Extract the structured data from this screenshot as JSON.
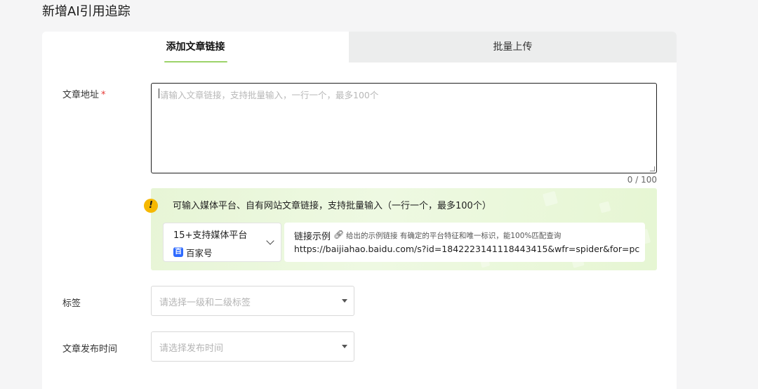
{
  "page": {
    "title": "新增AI引用追踪"
  },
  "tabs": [
    {
      "label": "添加文章链接",
      "active": true
    },
    {
      "label": "批量上传",
      "active": false
    }
  ],
  "form": {
    "article_url": {
      "label": "文章地址",
      "required_mark": "*",
      "placeholder": "请输入文章链接，支持批量输入，一行一个，最多100个",
      "value": "",
      "counter": "0 / 100"
    },
    "hint": {
      "text": "可输入媒体平台、自有网站文章链接，支持批量输入（一行一个，最多100个）",
      "platform_selector": {
        "title": "15+支持媒体平台",
        "selected": "百家号",
        "selected_icon": "baijiahao-icon"
      },
      "example": {
        "title": "链接示例",
        "note": "给出的示例链接 有确定的平台特征和唯一标识，能100%匹配查询",
        "url": "https://baijiahao.baidu.com/s?id=1842223141118443415&wfr=spider&for=pc"
      }
    },
    "tags": {
      "label": "标签",
      "placeholder": "请选择一级和二级标签"
    },
    "publish_time": {
      "label": "文章发布时间",
      "placeholder": "请选择发布时间"
    }
  },
  "colors": {
    "tab_underline": "#9cd36a",
    "hint_bg": "#e7f5d6",
    "warning": "#f6b800",
    "required": "#e53935",
    "baijiahao_blue": "#2f6bff"
  }
}
